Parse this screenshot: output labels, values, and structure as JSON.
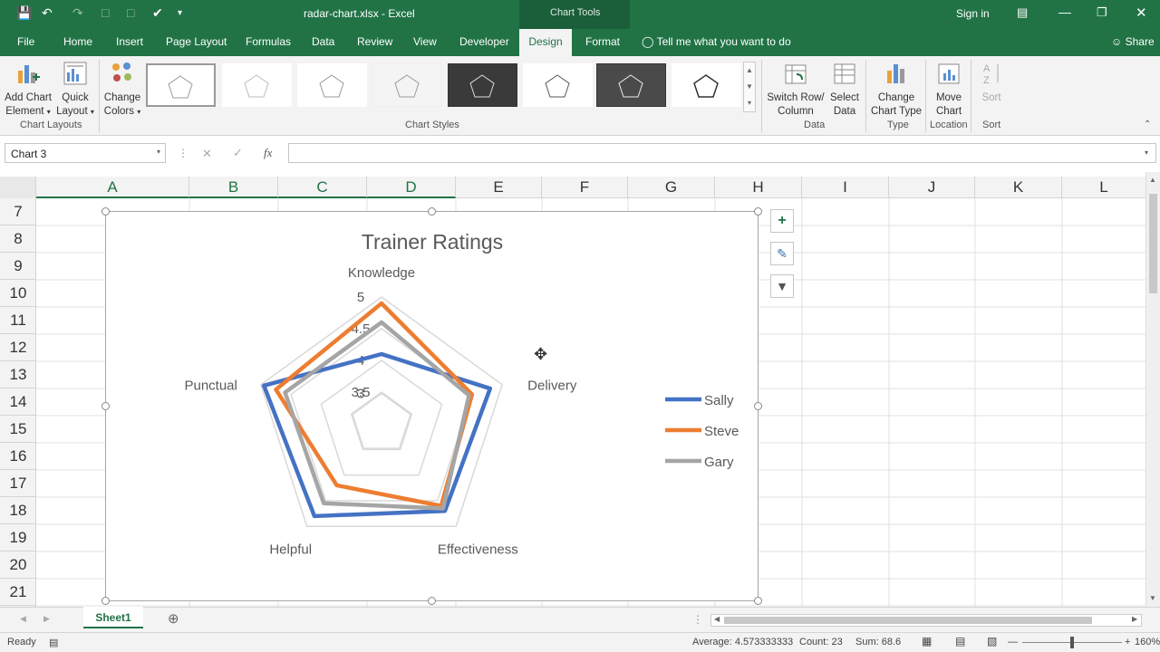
{
  "window": {
    "filename": "radar-chart.xlsx",
    "separator": "-",
    "app": "Excel",
    "context_label": "Chart Tools",
    "signin": "Sign in"
  },
  "tabs": [
    "File",
    "Home",
    "Insert",
    "Page Layout",
    "Formulas",
    "Data",
    "Review",
    "View",
    "Developer",
    "Design",
    "Format"
  ],
  "tell_me": "Tell me what you want to do",
  "share": "Share",
  "ribbon": {
    "add_chart_element": [
      "Add Chart",
      "Element"
    ],
    "quick_layout": [
      "Quick",
      "Layout"
    ],
    "change_colors": [
      "Change",
      "Colors"
    ],
    "switch_row_col": [
      "Switch Row/",
      "Column"
    ],
    "select_data": [
      "Select",
      "Data"
    ],
    "change_chart_type": [
      "Change",
      "Chart Type"
    ],
    "move_chart": [
      "Move",
      "Chart"
    ],
    "sort": "Sort",
    "groups": {
      "chart_layouts": "Chart Layouts",
      "chart_styles": "Chart Styles",
      "data": "Data",
      "type": "Type",
      "location": "Location",
      "sort": "Sort"
    }
  },
  "formula_bar": {
    "name_box": "Chart 3",
    "fx": "fx",
    "value": ""
  },
  "columns": [
    "A",
    "B",
    "C",
    "D",
    "E",
    "F",
    "G",
    "H",
    "I",
    "J",
    "K",
    "L"
  ],
  "rows": [
    "7",
    "8",
    "9",
    "10",
    "11",
    "12",
    "13",
    "14",
    "15",
    "16",
    "17",
    "18",
    "19",
    "20",
    "21"
  ],
  "chart_data": {
    "type": "radar",
    "title": "Trainer Ratings",
    "categories": [
      "Knowledge",
      "Delivery",
      "Effectiveness",
      "Helpful",
      "Punctual"
    ],
    "rlim": [
      3,
      5
    ],
    "ticks": [
      3,
      3.5,
      4,
      4.5,
      5
    ],
    "tick_labels": [
      "3",
      "3.5",
      "4",
      "4.5",
      "5"
    ],
    "legend_position": "right",
    "series": [
      {
        "name": "Sally",
        "color": "#4472c4",
        "values": [
          4.1,
          4.8,
          4.7,
          4.8,
          4.95
        ]
      },
      {
        "name": "Steve",
        "color": "#ed7d31",
        "values": [
          4.9,
          4.5,
          4.6,
          4.2,
          4.75
        ]
      },
      {
        "name": "Gary",
        "color": "#a5a5a5",
        "values": [
          4.6,
          4.45,
          4.65,
          4.55,
          4.6
        ]
      }
    ]
  },
  "sheet_tab": "Sheet1",
  "status": {
    "ready": "Ready",
    "average": "Average: 4.573333333",
    "count": "Count: 23",
    "sum": "Sum: 68.6",
    "zoom": "160%"
  }
}
